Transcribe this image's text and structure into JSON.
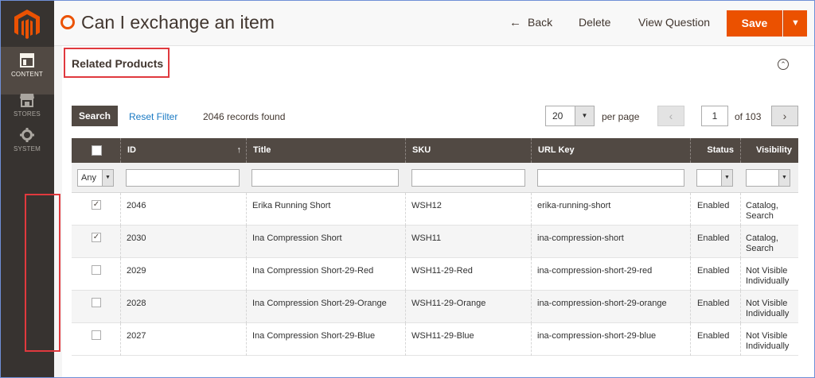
{
  "sidebar": {
    "logo": "magento-logo",
    "items": [
      {
        "label": "CONTENT",
        "icon": "content-icon",
        "active": true
      },
      {
        "label": "STORES",
        "icon": "stores-icon",
        "active": false
      },
      {
        "label": "SYSTEM",
        "icon": "gear-icon",
        "active": false
      }
    ]
  },
  "header": {
    "title": "Can I exchange an item",
    "back_label": "Back",
    "delete_label": "Delete",
    "view_question_label": "View Question",
    "save_label": "Save"
  },
  "section": {
    "title": "Related Products"
  },
  "toolbar": {
    "search_label": "Search",
    "reset_label": "Reset Filter",
    "records_text": "2046 records found",
    "per_page_value": "20",
    "per_page_label": "per page",
    "page_value": "1",
    "page_of": "of 103"
  },
  "grid": {
    "columns": [
      "ID",
      "Title",
      "SKU",
      "URL Key",
      "Status",
      "Visibility"
    ],
    "filter_any": "Any",
    "rows": [
      {
        "checked": true,
        "id": "2046",
        "title": "Erika Running Short",
        "sku": "WSH12",
        "url_key": "erika-running-short",
        "status": "Enabled",
        "visibility_1": "Catalog,",
        "visibility_2": "Search"
      },
      {
        "checked": true,
        "id": "2030",
        "title": "Ina Compression Short",
        "sku": "WSH11",
        "url_key": "ina-compression-short",
        "status": "Enabled",
        "visibility_1": "Catalog,",
        "visibility_2": "Search"
      },
      {
        "checked": false,
        "id": "2029",
        "title": "Ina Compression Short-29-Red",
        "sku": "WSH11-29-Red",
        "url_key": "ina-compression-short-29-red",
        "status": "Enabled",
        "visibility_1": "Not Visible",
        "visibility_2": "Individually"
      },
      {
        "checked": false,
        "id": "2028",
        "title": "Ina Compression Short-29-Orange",
        "sku": "WSH11-29-Orange",
        "url_key": "ina-compression-short-29-orange",
        "status": "Enabled",
        "visibility_1": "Not Visible",
        "visibility_2": "Individually"
      },
      {
        "checked": false,
        "id": "2027",
        "title": "Ina Compression Short-29-Blue",
        "sku": "WSH11-29-Blue",
        "url_key": "ina-compression-short-29-blue",
        "status": "Enabled",
        "visibility_1": "Not Visible",
        "visibility_2": "Individually"
      }
    ]
  },
  "colors": {
    "accent": "#eb5100",
    "sidebar": "#373330",
    "grid_header": "#514943",
    "link": "#1979c3",
    "highlight": "#e0393e"
  }
}
